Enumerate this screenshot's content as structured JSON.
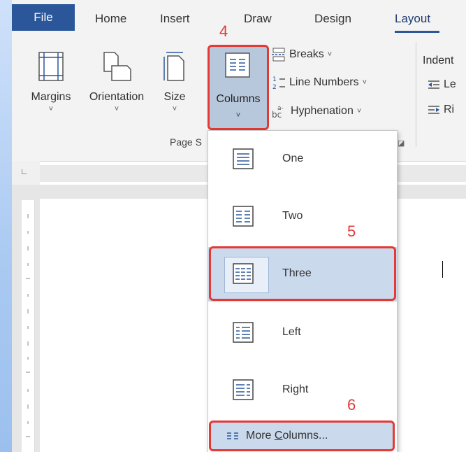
{
  "tabs": {
    "file": "File",
    "home": "Home",
    "insert": "Insert",
    "draw": "Draw",
    "design": "Design",
    "layout": "Layout"
  },
  "ribbon": {
    "margins": "Margins",
    "orientation": "Orientation",
    "size": "Size",
    "columns": "Columns",
    "breaks": "Breaks",
    "line_numbers": "Line Numbers",
    "hyphenation": "Hyphenation",
    "indent": "Indent",
    "indent_left": "Le",
    "indent_right": "Ri",
    "group_label": "Page S",
    "chevron": "˅"
  },
  "columns_menu": {
    "items": [
      {
        "label": "One"
      },
      {
        "label": "Two"
      },
      {
        "label": "Three"
      },
      {
        "label": "Left"
      },
      {
        "label": "Right"
      }
    ],
    "more_prefix": "More ",
    "more_underlined": "C",
    "more_suffix": "olumns...",
    "selected": "Three"
  },
  "annotations": {
    "step4": "4",
    "step5": "5",
    "step6": "6"
  },
  "colors": {
    "file_tab": "#2b579a",
    "highlight": "#e53935",
    "selection": "#cbd9ec",
    "icon_blue": "#2b579a"
  }
}
